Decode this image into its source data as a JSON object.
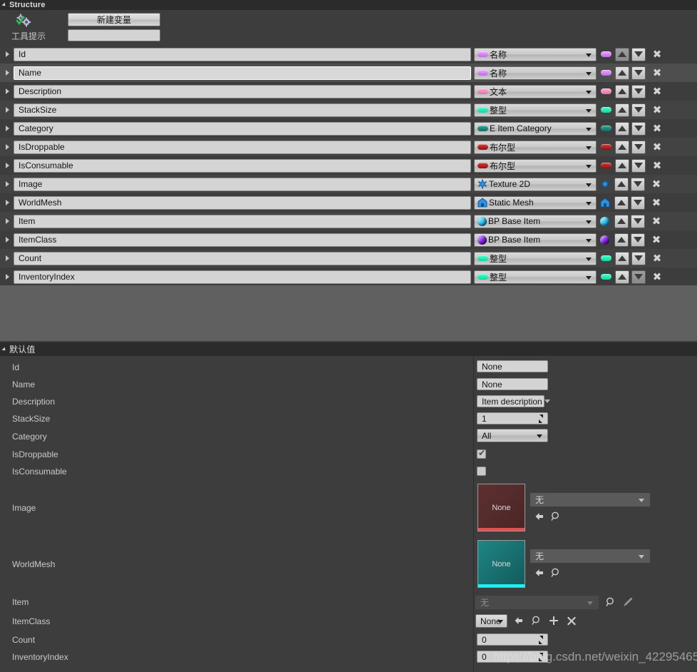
{
  "structure": {
    "header_title": "Structure",
    "gear_icon": "variable-gear-icon",
    "new_variable_label": "新建变量",
    "tooltip_label": "工具提示",
    "tooltip_value": "",
    "variables": [
      {
        "name": "Id",
        "type": "名称",
        "icon": "pill",
        "color": "#b96fe0",
        "selected": false,
        "up_dim": true,
        "down_dim": false
      },
      {
        "name": "Name",
        "type": "名称",
        "icon": "pill",
        "color": "#b96fe0",
        "selected": true,
        "up_dim": false,
        "down_dim": false
      },
      {
        "name": "Description",
        "type": "文本",
        "icon": "pill",
        "color": "#e0739f",
        "selected": false,
        "up_dim": false,
        "down_dim": false
      },
      {
        "name": "StackSize",
        "type": "整型",
        "icon": "pill",
        "color": "#16d39a",
        "selected": false,
        "up_dim": false,
        "down_dim": false
      },
      {
        "name": "Category",
        "type": "E Item Category",
        "icon": "pill",
        "color": "#0e6b63",
        "selected": false,
        "up_dim": false,
        "down_dim": false
      },
      {
        "name": "IsDroppable",
        "type": "布尔型",
        "icon": "pill",
        "color": "#9c0b0b",
        "selected": false,
        "up_dim": false,
        "down_dim": false
      },
      {
        "name": "IsConsumable",
        "type": "布尔型",
        "icon": "pill",
        "color": "#9c0b0b",
        "selected": false,
        "up_dim": false,
        "down_dim": false
      },
      {
        "name": "Image",
        "type": "Texture 2D",
        "icon": "star",
        "color": "#2f8fe0",
        "selected": false,
        "up_dim": false,
        "down_dim": false
      },
      {
        "name": "WorldMesh",
        "type": "Static Mesh",
        "icon": "house",
        "color": "#2f8fe0",
        "selected": false,
        "up_dim": false,
        "down_dim": false
      },
      {
        "name": "Item",
        "type": "BP Base Item",
        "icon": "sphere",
        "color": "#1ba7e8",
        "selected": false,
        "up_dim": false,
        "down_dim": false
      },
      {
        "name": "ItemClass",
        "type": "BP Base Item",
        "icon": "sphere",
        "color": "#6b11c9",
        "selected": false,
        "up_dim": false,
        "down_dim": false
      },
      {
        "name": "Count",
        "type": "整型",
        "icon": "pill",
        "color": "#16d39a",
        "selected": false,
        "up_dim": false,
        "down_dim": false
      },
      {
        "name": "InventoryIndex",
        "type": "整型",
        "icon": "pill",
        "color": "#16d39a",
        "selected": false,
        "up_dim": false,
        "down_dim": true
      }
    ],
    "row_buttons": {
      "move_up": "move-up",
      "move_down": "move-down",
      "delete": "✖"
    }
  },
  "defaults": {
    "header_title": "默认值",
    "rows": [
      {
        "label": "Id",
        "value": "None"
      },
      {
        "label": "Name",
        "value": "None"
      },
      {
        "label": "Description",
        "value": "Item description"
      },
      {
        "label": "StackSize",
        "value": "1"
      },
      {
        "label": "Category",
        "value": "All"
      },
      {
        "label": "IsDroppable",
        "value": "checked"
      },
      {
        "label": "IsConsumable",
        "value": "unchecked"
      },
      {
        "label": "Image",
        "value": "None",
        "asset": "无"
      },
      {
        "label": "WorldMesh",
        "value": "None",
        "asset": "无"
      },
      {
        "label": "Item",
        "value": "无"
      },
      {
        "label": "ItemClass",
        "value": "None"
      },
      {
        "label": "Count",
        "value": "0"
      },
      {
        "label": "InventoryIndex",
        "value": "0"
      }
    ],
    "image_thumb_label": "None",
    "image_thumb_bg": "#542b2b",
    "image_thumb_accent": "#e05252",
    "mesh_thumb_label": "None",
    "mesh_thumb_bg": "#18706f",
    "mesh_thumb_accent": "#22f0f0",
    "asset_none": "无",
    "class_none": "None"
  },
  "watermark": "https://blog.csdn.net/weixin_42295465"
}
